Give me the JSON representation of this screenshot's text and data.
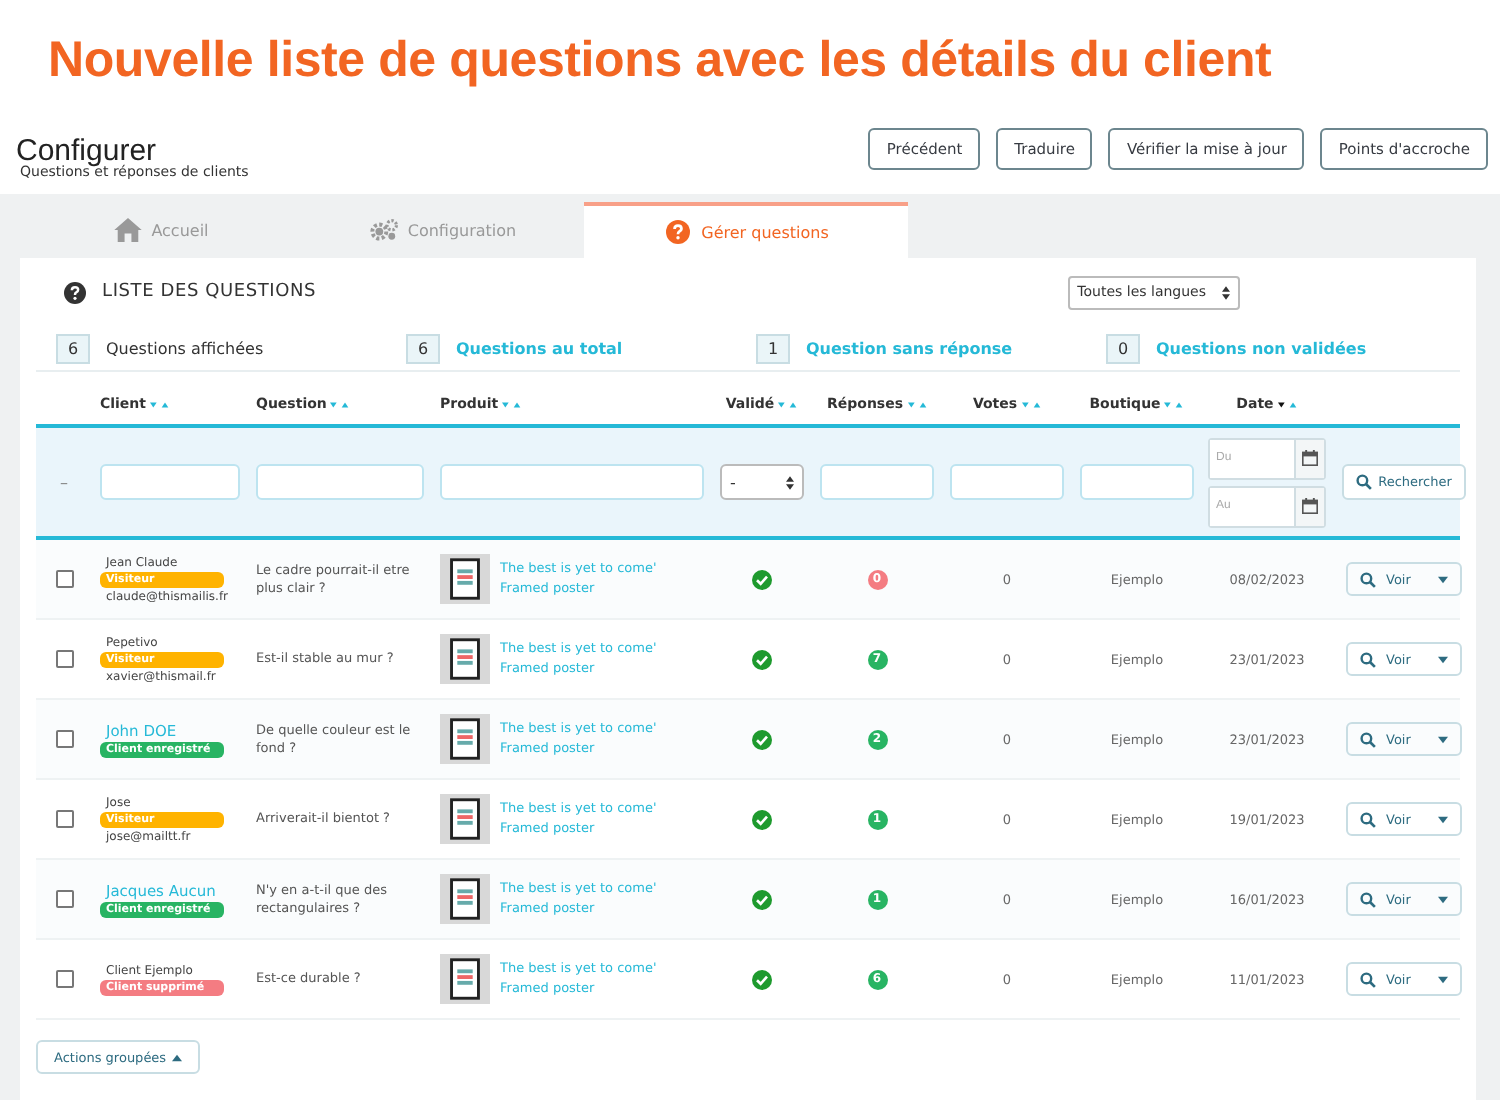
{
  "banner": {
    "title": "Nouvelle liste de questions avec les détails du client"
  },
  "header": {
    "title": "Configurer",
    "subtitle": "Questions et réponses de clients",
    "buttons": [
      "Précédent",
      "Traduire",
      "Vérifier la mise à jour",
      "Points d'accroche"
    ]
  },
  "tabs": [
    {
      "label": "Accueil",
      "kind": "home",
      "selected": false
    },
    {
      "label": "Configuration",
      "kind": "gears",
      "selected": false
    },
    {
      "label": "Gérer questions",
      "kind": "question",
      "selected": true
    }
  ],
  "panel": {
    "title": "LISTE DES QUESTIONS",
    "language_select": "Toutes les langues"
  },
  "stats": [
    {
      "count": "6",
      "label": "Questions affichées",
      "link": false
    },
    {
      "count": "6",
      "label": "Questions au total",
      "link": true
    },
    {
      "count": "1",
      "label": "Question sans réponse",
      "link": true
    },
    {
      "count": "0",
      "label": "Questions non validées",
      "link": true
    }
  ],
  "table": {
    "columns": [
      {
        "label": "Client",
        "sort_active": false
      },
      {
        "label": "Question",
        "sort_active": false
      },
      {
        "label": "Produit",
        "sort_active": false
      },
      {
        "label": "Validé",
        "sort_active": false
      },
      {
        "label": "Réponses",
        "sort_active": false
      },
      {
        "label": "Votes",
        "sort_active": false
      },
      {
        "label": "Boutique",
        "sort_active": false
      },
      {
        "label": "Date",
        "sort_active": true
      }
    ],
    "filters": {
      "reset": "–",
      "validated": "-",
      "date_from_placeholder": "Du",
      "date_to_placeholder": "Au",
      "search_button": "Rechercher"
    },
    "rows": [
      {
        "checked": false,
        "client": "Jean Claude",
        "registered": false,
        "status": {
          "label": "Visiteur",
          "color": "#ffb300"
        },
        "email": "claude@thismailis.fr",
        "question": "Le cadre pourrait-il etre plus clair ?",
        "product": "The best is yet to come' Framed poster",
        "validated": true,
        "answers": {
          "count": "0",
          "color": "#f47c82"
        },
        "votes": "0",
        "shop": "Ejemplo",
        "date": "08/02/2023",
        "action": "Voir"
      },
      {
        "checked": false,
        "client": "Pepetivo",
        "registered": false,
        "status": {
          "label": "Visiteur",
          "color": "#ffb300"
        },
        "email": "xavier@thismail.fr",
        "question": "Est-il stable au mur ?",
        "product": "The best is yet to come' Framed poster",
        "validated": true,
        "answers": {
          "count": "7",
          "color": "#28b463"
        },
        "votes": "0",
        "shop": "Ejemplo",
        "date": "23/01/2023",
        "action": "Voir"
      },
      {
        "checked": false,
        "client": "John DOE",
        "registered": true,
        "status": {
          "label": "Client enregistré",
          "color": "#28b463"
        },
        "question": "De quelle couleur est le fond ?",
        "product": "The best is yet to come' Framed poster",
        "validated": true,
        "answers": {
          "count": "2",
          "color": "#28b463"
        },
        "votes": "0",
        "shop": "Ejemplo",
        "date": "23/01/2023",
        "action": "Voir"
      },
      {
        "checked": false,
        "client": "Jose",
        "registered": false,
        "status": {
          "label": "Visiteur",
          "color": "#ffb300"
        },
        "email": "jose@mailtt.fr",
        "question": "Arriverait-il bientot ?",
        "product": "The best is yet to come' Framed poster",
        "validated": true,
        "answers": {
          "count": "1",
          "color": "#28b463"
        },
        "votes": "0",
        "shop": "Ejemplo",
        "date": "19/01/2023",
        "action": "Voir"
      },
      {
        "checked": false,
        "client": "Jacques Aucun",
        "registered": true,
        "status": {
          "label": "Client enregistré",
          "color": "#28b463"
        },
        "question": "N'y en a-t-il que des rectangulaires ?",
        "product": "The best is yet to come' Framed poster",
        "validated": true,
        "answers": {
          "count": "1",
          "color": "#28b463"
        },
        "votes": "0",
        "shop": "Ejemplo",
        "date": "16/01/2023",
        "action": "Voir"
      },
      {
        "checked": false,
        "client": "Client Ejemplo",
        "registered": false,
        "status": {
          "label": "Client supprimé",
          "color": "#f47c82"
        },
        "question": "Est-ce durable ?",
        "product": "The best is yet to come' Framed poster",
        "validated": true,
        "answers": {
          "count": "6",
          "color": "#28b463"
        },
        "votes": "0",
        "shop": "Ejemplo",
        "date": "11/01/2023",
        "action": "Voir"
      }
    ]
  },
  "bulk_actions": "Actions groupées"
}
